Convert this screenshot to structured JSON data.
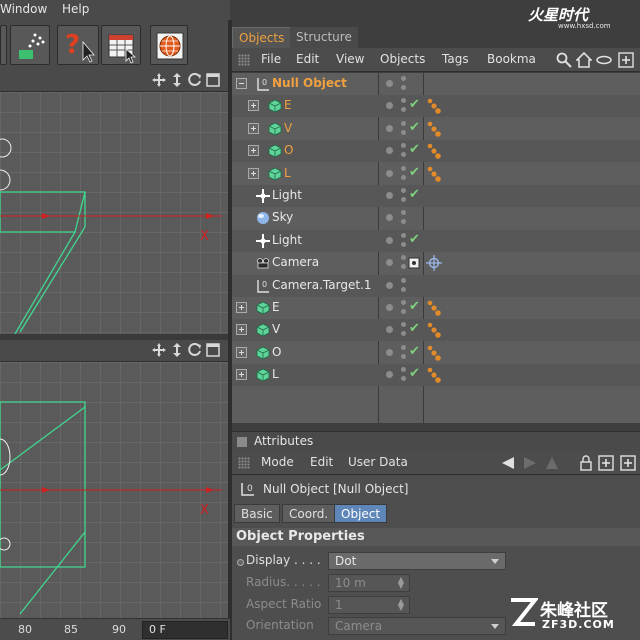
{
  "menubar": {
    "items": [
      "Window",
      "Help"
    ]
  },
  "viewport": {
    "axis_label": "X"
  },
  "timeline": {
    "ticks": [
      "80",
      "85",
      "90"
    ],
    "frame": "0 F"
  },
  "objects_manager": {
    "tabs": [
      {
        "label": "Objects",
        "active": true
      },
      {
        "label": "Structure",
        "active": false
      }
    ],
    "menu": [
      "File",
      "Edit",
      "View",
      "Objects",
      "Tags",
      "Bookma"
    ],
    "rows": [
      {
        "name": "Null Object",
        "icon": "null-icon",
        "color": "orange",
        "bold": true,
        "expander": "minus",
        "indent": 0,
        "check": false,
        "tag": "none"
      },
      {
        "name": "E",
        "icon": "cube-icon",
        "color": "orange",
        "expander": "plus",
        "indent": 1,
        "check": true,
        "tag": "phong"
      },
      {
        "name": "V",
        "icon": "cube-icon",
        "color": "orange",
        "expander": "plus",
        "indent": 1,
        "check": true,
        "tag": "phong"
      },
      {
        "name": "O",
        "icon": "cube-icon",
        "color": "orange",
        "expander": "plus",
        "indent": 1,
        "check": true,
        "tag": "phong"
      },
      {
        "name": "L",
        "icon": "cube-icon",
        "color": "orange",
        "expander": "plus",
        "indent": 1,
        "check": true,
        "tag": "phong"
      },
      {
        "name": "Light",
        "icon": "light-icon",
        "color": "white",
        "expander": "none",
        "indent": 0,
        "check": true,
        "tag": "none"
      },
      {
        "name": "Sky",
        "icon": "sky-icon",
        "color": "white",
        "expander": "none",
        "indent": 0,
        "check": false,
        "tag": "none"
      },
      {
        "name": "Light",
        "icon": "light-icon",
        "color": "white",
        "expander": "none",
        "indent": 0,
        "check": true,
        "tag": "none"
      },
      {
        "name": "Camera",
        "icon": "camera-icon",
        "color": "white",
        "expander": "none",
        "indent": 0,
        "check": false,
        "tag": "target",
        "render_box": true
      },
      {
        "name": "Camera.Target.1",
        "icon": "null-icon",
        "color": "white",
        "expander": "none",
        "indent": 0,
        "check": false,
        "tag": "none"
      },
      {
        "name": "E",
        "icon": "cube-icon",
        "color": "white",
        "expander": "plus",
        "indent": 0,
        "check": true,
        "tag": "phong"
      },
      {
        "name": "V",
        "icon": "cube-icon",
        "color": "white",
        "expander": "plus",
        "indent": 0,
        "check": true,
        "tag": "phong"
      },
      {
        "name": "O",
        "icon": "cube-icon",
        "color": "white",
        "expander": "plus",
        "indent": 0,
        "check": true,
        "tag": "phong"
      },
      {
        "name": "L",
        "icon": "cube-icon",
        "color": "white",
        "expander": "plus",
        "indent": 0,
        "check": true,
        "tag": "phong"
      }
    ]
  },
  "attributes": {
    "title": "Attributes",
    "menu": [
      "Mode",
      "Edit",
      "User Data"
    ],
    "header": "Null Object [Null Object]",
    "tabs": [
      {
        "label": "Basic",
        "active": false
      },
      {
        "label": "Coord.",
        "active": false
      },
      {
        "label": "Object",
        "active": true
      }
    ],
    "section": "Object Properties",
    "props": [
      {
        "label": "Display . . . .",
        "value": "Dot",
        "enabled": true,
        "kind": "dropdown"
      },
      {
        "label": "Radius. . . . .",
        "value": "10 m",
        "enabled": false,
        "kind": "spinner"
      },
      {
        "label": "Aspect Ratio",
        "value": "1",
        "enabled": false,
        "kind": "spinner"
      },
      {
        "label": "Orientation",
        "value": "Camera",
        "enabled": false,
        "kind": "dropdown"
      }
    ]
  },
  "watermarks": {
    "top": {
      "logo": "火星时代",
      "url": "www.hxsd.com"
    },
    "bottom": {
      "logo": "朱峰社区",
      "url": "ZF3D.COM"
    }
  },
  "colors": {
    "accent_orange": "#f0a040",
    "check_green": "#7fd17f",
    "tab_blue": "#5e86b8",
    "axis_red": "#d02020",
    "wire_green": "#40d890"
  }
}
